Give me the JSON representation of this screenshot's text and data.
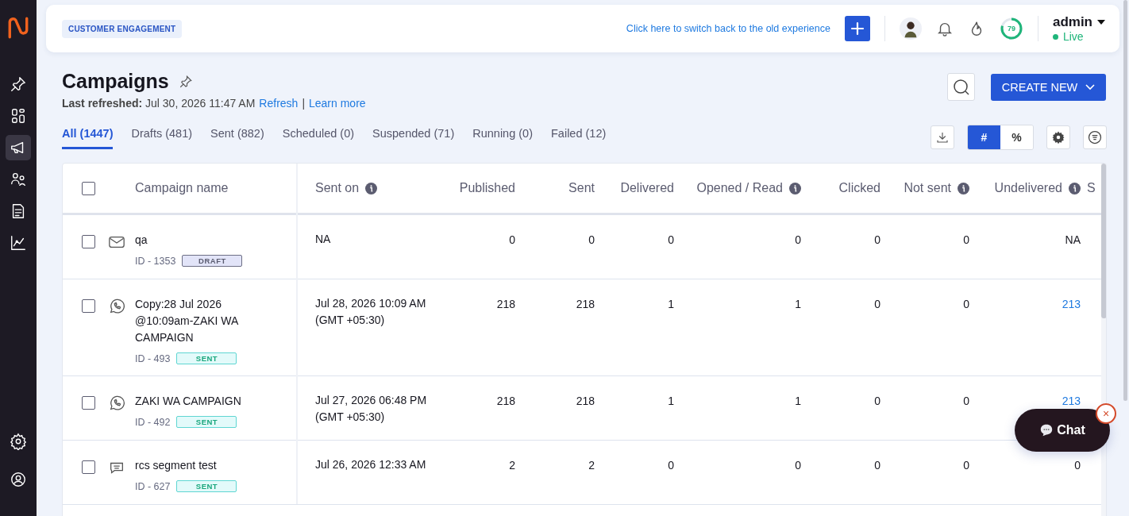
{
  "sidebar": {
    "items": [
      {
        "kind": "pin",
        "selected": false
      },
      {
        "kind": "dashboard",
        "selected": false
      },
      {
        "kind": "megaphone",
        "selected": true
      },
      {
        "kind": "users",
        "selected": false
      },
      {
        "kind": "document",
        "selected": false
      },
      {
        "kind": "chart",
        "selected": false
      }
    ],
    "bottom_items": [
      {
        "kind": "settings",
        "selected": false
      },
      {
        "kind": "profile",
        "selected": false
      }
    ]
  },
  "topbar": {
    "module": "CUSTOMER ENGAGEMENT",
    "switch_link": "Click here to switch back to the old experience",
    "score": {
      "value": "79"
    },
    "user": "admin",
    "status": "Live"
  },
  "header": {
    "title": "Campaigns",
    "last_refreshed_label": "Last refreshed:",
    "last_refreshed": "Jul 30, 2026 11:47 AM",
    "refresh_link": "Refresh",
    "separator": "|",
    "learn_more": "Learn more",
    "create_button": "CREATE NEW"
  },
  "tabs": [
    {
      "label": "All (1447)",
      "selected": true
    },
    {
      "label": "Drafts (481)",
      "selected": false
    },
    {
      "label": "Sent (882)",
      "selected": false
    },
    {
      "label": "Scheduled (0)",
      "selected": false
    },
    {
      "label": "Suspended (71)",
      "selected": false
    },
    {
      "label": "Running (0)",
      "selected": false
    },
    {
      "label": "Failed (12)",
      "selected": false
    }
  ],
  "view_toggle": [
    {
      "label": "#",
      "selected": true
    },
    {
      "label": "%",
      "selected": false
    }
  ],
  "table": {
    "select_all_checked": false,
    "columns": [
      {
        "label": "Campaign name",
        "info": false
      },
      {
        "label": "Sent on",
        "info": true
      },
      {
        "label": "Published",
        "info": false
      },
      {
        "label": "Sent",
        "info": false
      },
      {
        "label": "Delivered",
        "info": false
      },
      {
        "label": "Opened / Read",
        "info": true
      },
      {
        "label": "Clicked",
        "info": false
      },
      {
        "label": "Not sent",
        "info": true
      },
      {
        "label": "Undelivered",
        "info": true
      },
      {
        "label": "S",
        "info": false
      }
    ],
    "rows": [
      {
        "checked": false,
        "kind": "email",
        "name": "qa",
        "id": "ID - 1353",
        "status": {
          "kind": "draft",
          "label": "DRAFT"
        },
        "sent_on": "NA",
        "published": "0",
        "sent": "0",
        "delivered": "0",
        "opened": "0",
        "clicked": "0",
        "not_sent": "0",
        "undelivered": "NA",
        "undelivered_link": false
      },
      {
        "checked": false,
        "kind": "whatsapp",
        "name": "Copy:28 Jul 2026 @10:09am-ZAKI WA CAMPAIGN",
        "id": "ID - 493",
        "status": {
          "kind": "sent",
          "label": "SENT"
        },
        "sent_on": "Jul 28, 2026 10:09 AM",
        "timezone": "(GMT +05:30)",
        "published": "218",
        "sent": "218",
        "delivered": "1",
        "opened": "1",
        "clicked": "0",
        "not_sent": "0",
        "undelivered": "213",
        "undelivered_link": true
      },
      {
        "checked": false,
        "kind": "whatsapp",
        "name": "ZAKI WA CAMPAIGN",
        "id": "ID - 492",
        "status": {
          "kind": "sent",
          "label": "SENT"
        },
        "sent_on": "Jul 27, 2026 06:48 PM",
        "timezone": "(GMT +05:30)",
        "published": "218",
        "sent": "218",
        "delivered": "1",
        "opened": "1",
        "clicked": "0",
        "not_sent": "0",
        "undelivered": "213",
        "undelivered_link": true
      },
      {
        "checked": false,
        "kind": "rcs",
        "name": "rcs segment test",
        "id": "ID - 627",
        "status": {
          "kind": "sent",
          "label": "SENT"
        },
        "sent_on": "Jul 26, 2026 12:33 AM",
        "published": "2",
        "sent": "2",
        "delivered": "0",
        "opened": "0",
        "clicked": "0",
        "not_sent": "0",
        "undelivered": "0",
        "undelivered_link": false
      }
    ]
  },
  "chat": {
    "label": "Chat",
    "close": "×"
  }
}
